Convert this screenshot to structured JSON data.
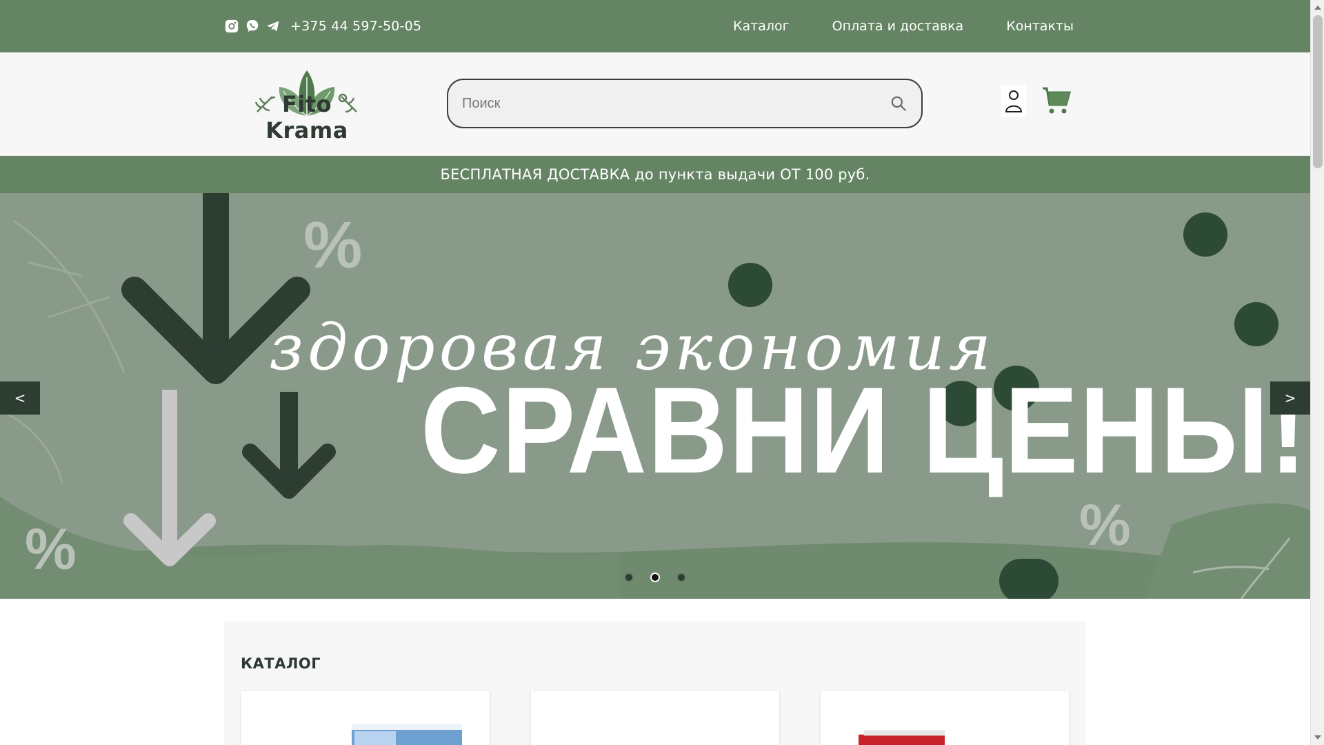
{
  "topbar": {
    "phone": "+375 44 597-50-05",
    "social_icons": [
      "instagram-icon",
      "viber-icon",
      "telegram-icon"
    ],
    "nav": [
      "Каталог",
      "Оплата и доставка",
      "Контакты"
    ]
  },
  "header": {
    "logo_text": "Fito Krama",
    "search": {
      "placeholder": "Поиск",
      "value": ""
    }
  },
  "promo": {
    "text": "БЕСПЛАТНАЯ ДОСТАВКА до пункта выдачи ОТ 100 руб."
  },
  "hero": {
    "script": "здоровая экономия",
    "headline": "СРАВНИ ЦЕНЫ!",
    "prev_label": "<",
    "next_label": ">",
    "active_slide": 2,
    "slide_count": 3
  },
  "catalog": {
    "title": "КАТАЛОГ"
  },
  "colors": {
    "brand_green": "#648463",
    "hero_bg": "#8a9a8a",
    "dark_green": "#2d3d32"
  }
}
